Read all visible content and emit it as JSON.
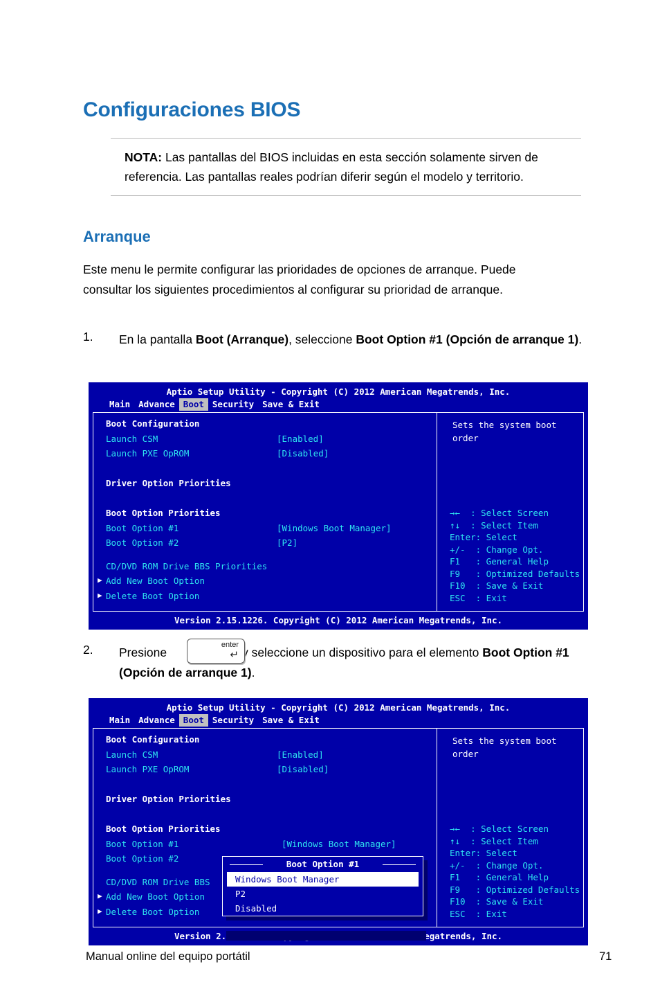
{
  "page": {
    "heading": "Configuraciones BIOS",
    "note_label": "NOTA:",
    "note_text": " Las pantallas del BIOS incluidas en esta sección solamente sirven de referencia. Las pantallas reales podrían diferir según el modelo y territorio.",
    "section_heading": "Arranque",
    "intro": "Este menu le permite configurar las prioridades de opciones de arranque. Puede consultar los siguientes procedimientos al configurar su prioridad de arranque.",
    "step1_num": "1.",
    "step1_a": "En la pantalla ",
    "step1_b": "Boot (Arranque)",
    "step1_c": ", seleccione ",
    "step1_d": "Boot Option #1 (Opción de arranque 1)",
    "step1_e": ".",
    "step2_num": "2.",
    "step2_a": "Presione",
    "step2_b": "y seleccione un dispositivo para el elemento",
    "step2_c": "Boot Option #1 (Opción de arranque 1)",
    "step2_d": ".",
    "enter_key_label": "enter",
    "enter_key_arrow": "↵",
    "footer_left": "Manual online del equipo portátil",
    "footer_right": "71"
  },
  "bios": {
    "title": "Aptio Setup Utility - Copyright (C) 2012 American Megatrends, Inc.",
    "footer": "Version 2.15.1226. Copyright (C) 2012 American Megatrends, Inc.",
    "menu": [
      "Main",
      "Advance",
      "Boot",
      "Security",
      "Save & Exit"
    ],
    "active_menu": "Boot",
    "rows": [
      {
        "label": "Boot Configuration",
        "value": "",
        "style": "white"
      },
      {
        "label": "Launch CSM",
        "value": "[Enabled]",
        "style": "cyan"
      },
      {
        "label": "Launch PXE OpROM",
        "value": "[Disabled]",
        "style": "cyan"
      },
      {
        "label": "",
        "value": "",
        "style": "cyan"
      },
      {
        "label": "Driver Option Priorities",
        "value": "",
        "style": "white"
      },
      {
        "label": "",
        "value": "",
        "style": "cyan"
      },
      {
        "label": "Boot Option Priorities",
        "value": "",
        "style": "white"
      },
      {
        "label": "Boot Option #1",
        "value": "[Windows Boot Manager]",
        "style": "cyan"
      },
      {
        "label": "Boot Option #2",
        "value": "[P2]",
        "style": "cyan"
      }
    ],
    "bottom_rows": [
      {
        "label": "CD/DVD ROM Drive BBS Priorities",
        "arrow": false
      },
      {
        "label": "Add New Boot Option",
        "arrow": true
      },
      {
        "label": "Delete Boot Option",
        "arrow": true
      }
    ],
    "bottom_rows_2": [
      {
        "label": "CD/DVD ROM Drive BBS",
        "arrow": false
      },
      {
        "label": "Add New Boot Option",
        "arrow": true
      },
      {
        "label": "Delete Boot Option",
        "arrow": true
      }
    ],
    "help_text": "Sets the system boot\norder",
    "key_help": "→←  : Select Screen\n↑↓  : Select Item\nEnter: Select\n+/-  : Change Opt.\nF1   : General Help\nF9   : Optimized Defaults\nF10  : Save & Exit\nESC  : Exit",
    "popup": {
      "title": "Boot Option #1",
      "items": [
        "Windows Boot Manager",
        "P2",
        "Disabled"
      ],
      "selected": "Windows Boot Manager"
    }
  }
}
